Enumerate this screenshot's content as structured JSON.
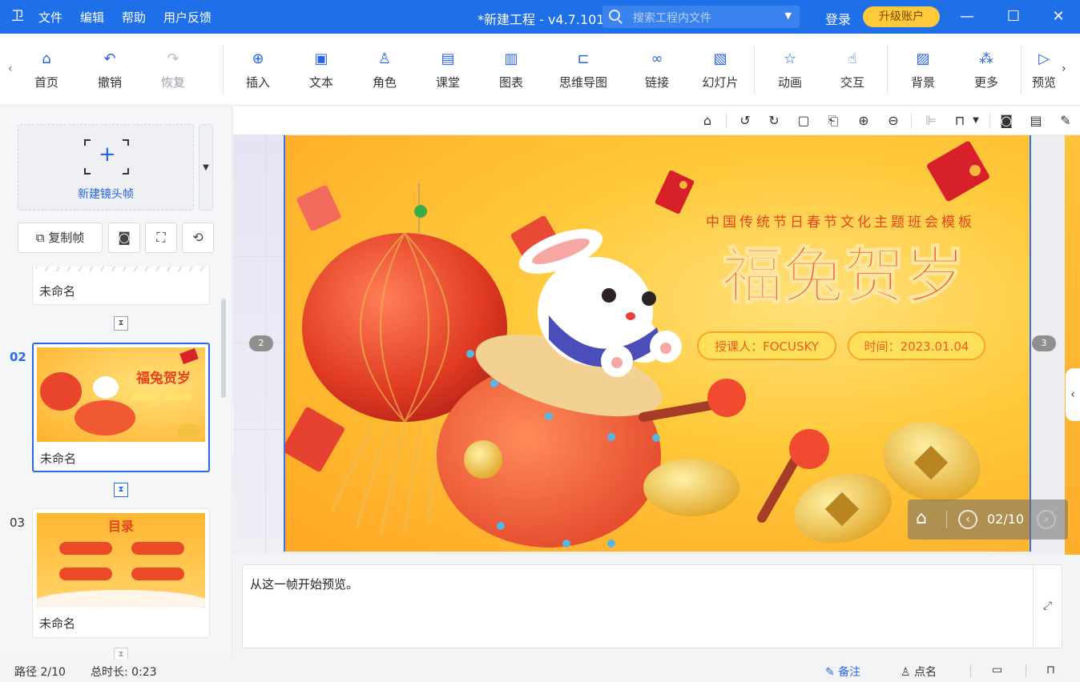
{
  "titlebar": {
    "logo_icon": "app-logo-icon",
    "menu": [
      "文件",
      "编辑",
      "帮助",
      "用户反馈"
    ],
    "doc_title": "*新建工程 - v4.7.101",
    "search_placeholder": "搜索工程内文件",
    "login": "登录",
    "upgrade": "升级账户"
  },
  "toolbar": {
    "items": [
      {
        "label": "首页",
        "icon": "home-icon"
      },
      {
        "label": "撤销",
        "icon": "undo-icon"
      },
      {
        "label": "恢复",
        "icon": "redo-icon",
        "disabled": true
      },
      {
        "label": "插入",
        "icon": "insert-icon"
      },
      {
        "label": "文本",
        "icon": "text-icon"
      },
      {
        "label": "角色",
        "icon": "character-icon"
      },
      {
        "label": "课堂",
        "icon": "classroom-icon"
      },
      {
        "label": "图表",
        "icon": "chart-icon"
      },
      {
        "label": "思维导图",
        "icon": "mindmap-icon"
      },
      {
        "label": "链接",
        "icon": "link-icon"
      },
      {
        "label": "幻灯片",
        "icon": "slides-icon"
      },
      {
        "label": "动画",
        "icon": "animation-icon"
      },
      {
        "label": "交互",
        "icon": "interaction-icon"
      },
      {
        "label": "背景",
        "icon": "background-icon"
      },
      {
        "label": "更多",
        "icon": "more-icon"
      },
      {
        "label": "预览",
        "icon": "preview-icon"
      }
    ]
  },
  "left": {
    "new_frame": "新建镜头帧",
    "copy_frame": "复制帧",
    "frames": [
      {
        "num": "",
        "name": "未命名"
      },
      {
        "num": "02",
        "name": "未命名"
      },
      {
        "num": "03",
        "name": "未命名"
      }
    ]
  },
  "slide": {
    "subtitle": "中国传统节日春节文化主题班会模板",
    "title": "福兔贺岁",
    "teacher": "授课人：FOCUSKY",
    "date": "时间：2023.01.04",
    "prev_badge": "2",
    "next_badge": "3",
    "page": "02/10",
    "thumb3_title": "目录"
  },
  "notes": {
    "text": "从这一帧开始预览。"
  },
  "status": {
    "path": "路径 2/10",
    "duration": "总时长: 0:23",
    "notes": "备注",
    "rollcall": "点名"
  }
}
